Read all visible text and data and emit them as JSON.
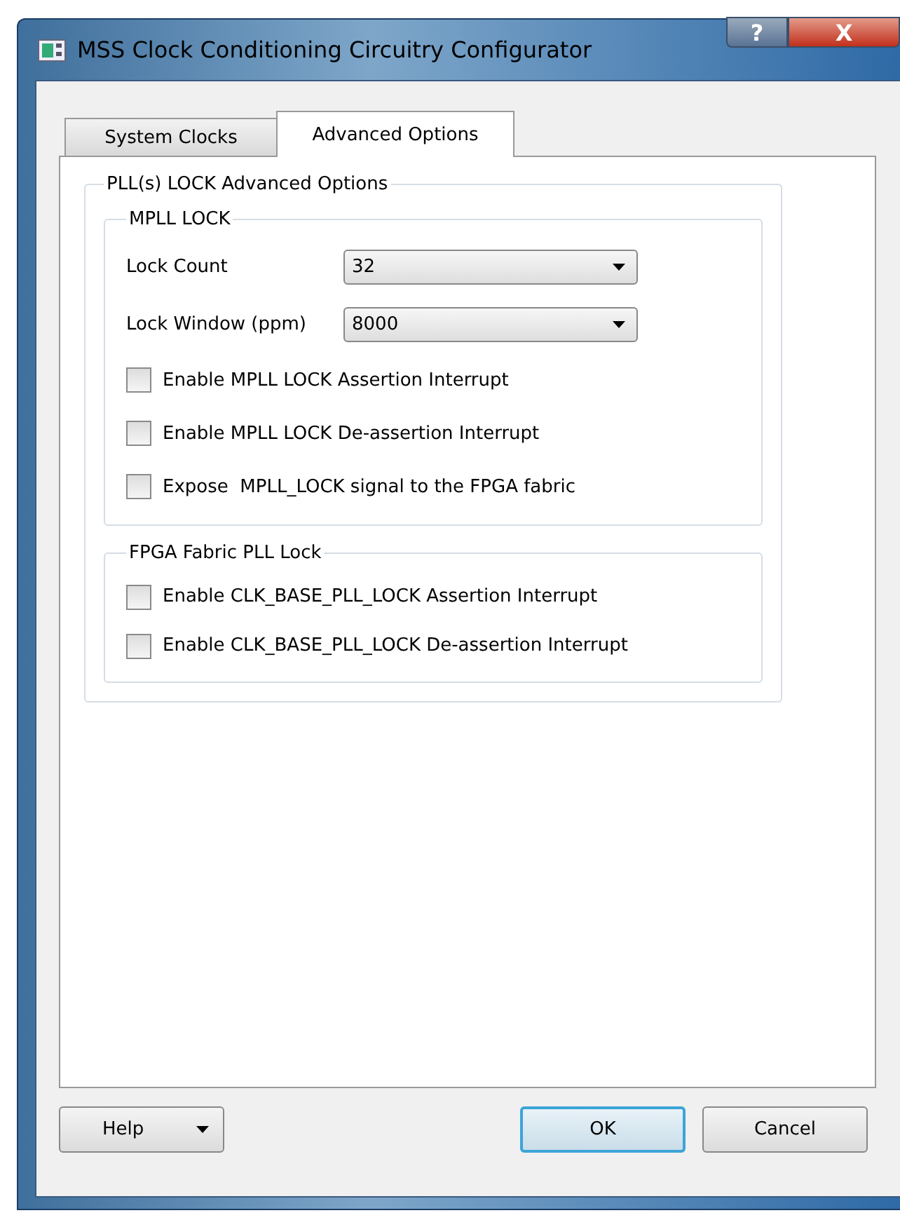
{
  "window": {
    "title": "MSS Clock Conditioning Circuitry Configurator",
    "help_glyph": "?",
    "close_glyph": "X"
  },
  "tabs": [
    {
      "label": "System Clocks",
      "selected": false
    },
    {
      "label": "Advanced Options",
      "selected": true
    }
  ],
  "outer_group": {
    "title": "PLL(s) LOCK Advanced Options",
    "groups": [
      {
        "title": "MPLL LOCK",
        "fields": [
          {
            "label": "Lock Count",
            "value": "32"
          },
          {
            "label": "Lock Window (ppm)",
            "value": "8000"
          }
        ],
        "checkboxes": [
          {
            "label": "Enable MPLL LOCK Assertion Interrupt",
            "checked": false
          },
          {
            "label": "Enable MPLL LOCK De-assertion Interrupt",
            "checked": false
          },
          {
            "label": "Expose  MPLL_LOCK signal to the FPGA fabric",
            "checked": false
          }
        ]
      },
      {
        "title": "FPGA Fabric PLL Lock",
        "checkboxes": [
          {
            "label": "Enable CLK_BASE_PLL_LOCK Assertion Interrupt",
            "checked": false
          },
          {
            "label": "Enable CLK_BASE_PLL_LOCK De-assertion Interrupt",
            "checked": false
          }
        ]
      }
    ]
  },
  "buttons": [
    {
      "label": "Help",
      "kind": "menu"
    },
    {
      "label": "OK",
      "kind": "default"
    },
    {
      "label": "Cancel",
      "kind": "plain"
    }
  ]
}
